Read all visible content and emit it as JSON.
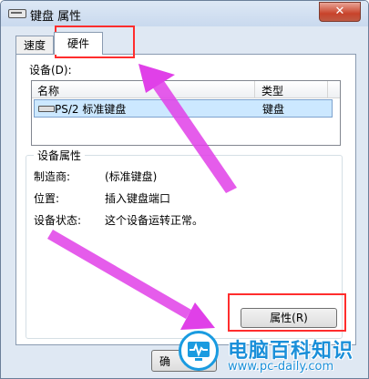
{
  "window": {
    "title": "键盘 属性",
    "close_label": "✕"
  },
  "tabs": [
    {
      "label": "速度"
    },
    {
      "label": "硬件"
    }
  ],
  "devices": {
    "label": "设备(D):",
    "columns": [
      "名称",
      "类型"
    ],
    "rows": [
      {
        "name": "PS/2 标准键盘",
        "type": "键盘"
      }
    ]
  },
  "properties": {
    "group_title": "设备属性",
    "items": [
      {
        "label": "制造商:",
        "value": "(标准键盘)"
      },
      {
        "label": "位置:",
        "value": "插入键盘端口"
      },
      {
        "label": "设备状态:",
        "value": "这个设备运转正常。"
      }
    ],
    "button_label": "属性(R)"
  },
  "footer": {
    "ok_label": "确"
  },
  "watermark": {
    "text": "电脑百科知识",
    "url": "www.pc-daily.com"
  },
  "colors": {
    "annotation": "#ff2d2d",
    "arrow": "#e040e8",
    "watermark": "#1a8fd9"
  }
}
